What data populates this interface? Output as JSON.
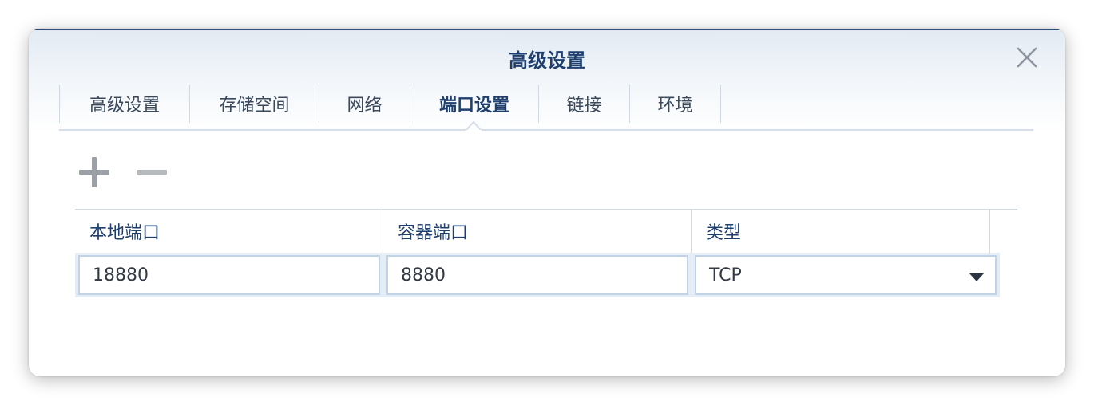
{
  "dialog": {
    "title": "高级设置",
    "close_icon": "close-icon"
  },
  "tabs": [
    {
      "label": "高级设置",
      "active": false
    },
    {
      "label": "存储空间",
      "active": false
    },
    {
      "label": "网络",
      "active": false
    },
    {
      "label": "端口设置",
      "active": true
    },
    {
      "label": "链接",
      "active": false
    },
    {
      "label": "环境",
      "active": false
    }
  ],
  "toolbar": {
    "add_icon": "plus-icon",
    "remove_icon": "minus-icon"
  },
  "port_table": {
    "columns": [
      "本地端口",
      "容器端口",
      "类型"
    ],
    "rows": [
      {
        "local_port": "18880",
        "container_port": "8880",
        "type": "TCP"
      }
    ]
  },
  "colors": {
    "title": "#1f3f6e",
    "header_border": "#2d4d7a",
    "row_highlight": "#e4ecf5"
  }
}
